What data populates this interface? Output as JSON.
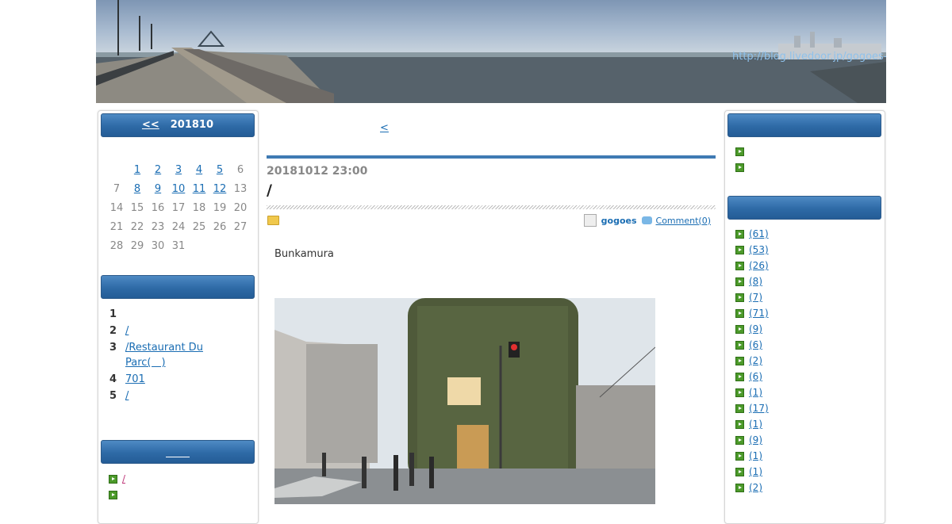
{
  "header": {
    "blog_url": "http://blog.livedoor.jp/gogoes-eriverni/newspaper/"
  },
  "calendar": {
    "prev_label": "<<",
    "month": "201810",
    "weeks": [
      [
        "",
        "1",
        "2",
        "3",
        "4",
        "5",
        "6"
      ],
      [
        "7",
        "8",
        "9",
        "10",
        "11",
        "12",
        "13"
      ],
      [
        "14",
        "15",
        "16",
        "17",
        "18",
        "19",
        "20"
      ],
      [
        "21",
        "22",
        "23",
        "24",
        "25",
        "26",
        "27"
      ],
      [
        "28",
        "29",
        "30",
        "31",
        "",
        "",
        ""
      ]
    ],
    "linked_days": [
      "1",
      "2",
      "3",
      "4",
      "5",
      "8",
      "9",
      "10",
      "11",
      "12"
    ]
  },
  "ranking": {
    "header": "",
    "items": [
      {
        "rank": "1",
        "label": ""
      },
      {
        "rank": "2",
        "label": "/"
      },
      {
        "rank": "3",
        "label": "/Restaurant Du Parc(　)"
      },
      {
        "rank": "4",
        "label": "701"
      },
      {
        "rank": "5",
        "label": "/"
      }
    ]
  },
  "recent": {
    "header": "",
    "items": [
      "/",
      ""
    ]
  },
  "post": {
    "nav_prev": "<",
    "date": "20181012 23:00",
    "title": "/",
    "author": "gogoes",
    "comment_link": "Comment(0)",
    "body": "Bunkamura"
  },
  "right_links": {
    "header": "",
    "items": [
      "",
      ""
    ]
  },
  "categories": {
    "header": "",
    "items": [
      "(61)",
      "(53)",
      "(26)",
      "(8)",
      "(7)",
      "(71)",
      "(9)",
      "(6)",
      "(2)",
      "(6)",
      "(1)",
      "(17)",
      "(1)",
      "(9)",
      "(1)",
      "(1)",
      "(2)"
    ]
  },
  "colors": {
    "header_bar": "#2e6aa6",
    "link": "#1a6db3",
    "bullet": "#4c9a2a"
  }
}
